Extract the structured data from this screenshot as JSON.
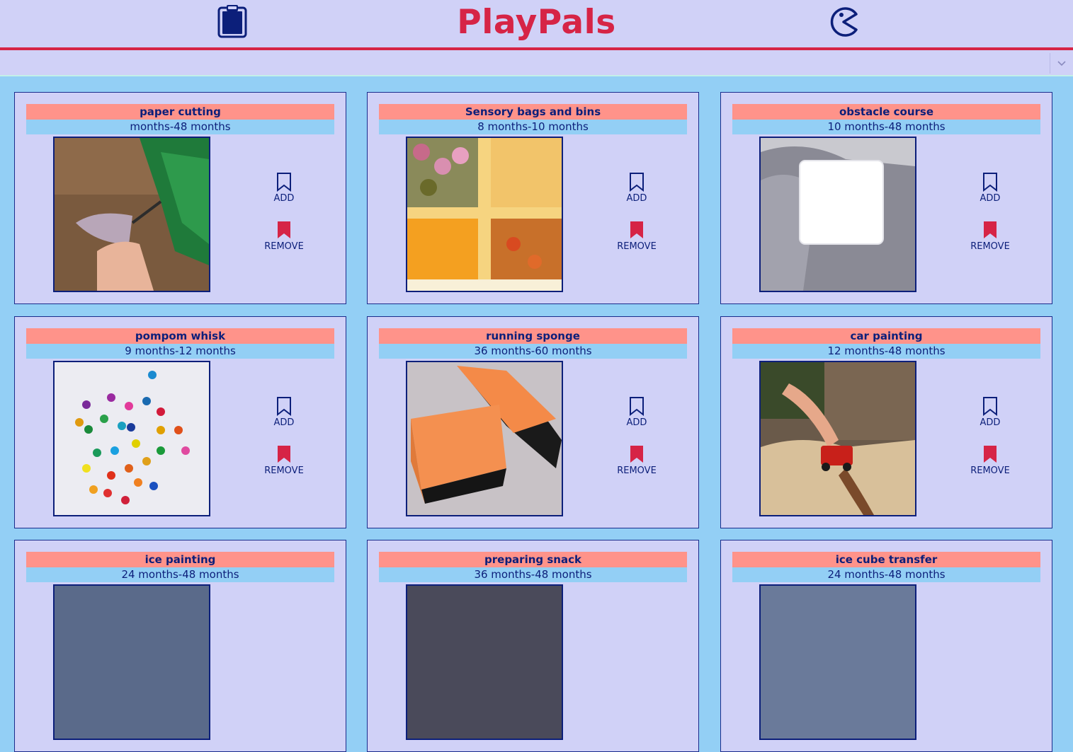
{
  "header": {
    "brand": "PlayPals",
    "left_icon": "clipboard-icon",
    "right_icon": "pacman-icon",
    "brand_color": "#d62446",
    "accent_color": "#0c1f7a"
  },
  "filter": {
    "selected": ""
  },
  "actions": {
    "add_label": "ADD",
    "remove_label": "REMOVE"
  },
  "cards": [
    {
      "title": "paper cutting",
      "age": "months-48 months",
      "image": "child-cutting-paper"
    },
    {
      "title": "Sensory bags and bins",
      "age": "8 months-10 months",
      "image": "pasta-sensory-bin"
    },
    {
      "title": "obstacle course",
      "age": "10 months-48 months",
      "image": "pillow-on-blanket"
    },
    {
      "title": "pompom whisk",
      "age": "9 months-12 months",
      "image": "colorful-pompoms"
    },
    {
      "title": "running sponge",
      "age": "36 months-60 months",
      "image": "orange-sponges"
    },
    {
      "title": "car painting",
      "age": "12 months-48 months",
      "image": "toy-car-on-rock"
    },
    {
      "title": "ice painting",
      "age": "24 months-48 months",
      "image": "ice-painting"
    },
    {
      "title": "preparing snack",
      "age": "36 months-48 months",
      "image": "snack-prep"
    },
    {
      "title": "ice cube transfer",
      "age": "24 months-48 months",
      "image": "ice-cubes"
    }
  ]
}
